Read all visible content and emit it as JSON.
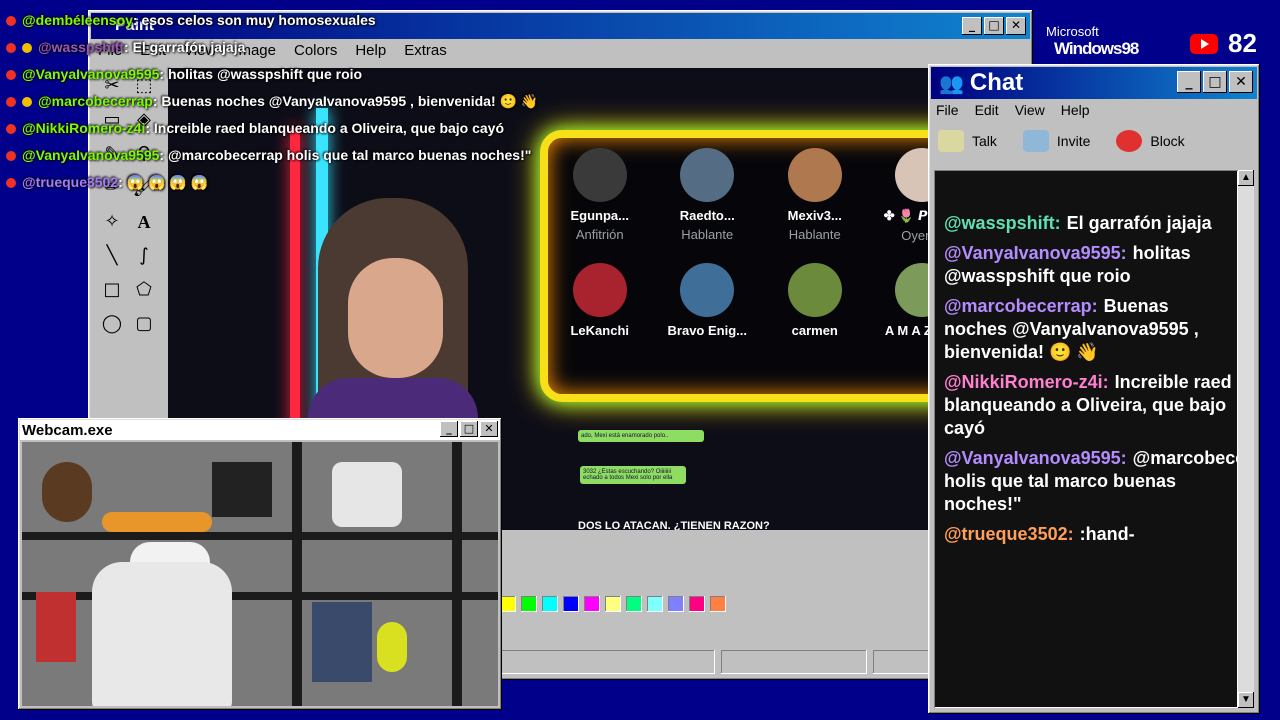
{
  "paint": {
    "title": "Paint",
    "menu": [
      "File",
      "Edit",
      "View",
      "Image",
      "Colors",
      "Help",
      "Extras"
    ],
    "palette": [
      "#ffff00",
      "#00ff00",
      "#00ffff",
      "#0000ff",
      "#ff00ff",
      "#ffff80",
      "#00ff80",
      "#80ffff",
      "#8080ff",
      "#ff0080",
      "#ff8040"
    ]
  },
  "stream": {
    "speakers": [
      {
        "name": "Egunpa...",
        "role": "Anfitrión"
      },
      {
        "name": "Raedto...",
        "role": "Hablante"
      },
      {
        "name": "Mexiv3...",
        "role": "Hablante"
      },
      {
        "name": "✤ 🌷 𝙋𝙞𝙣𝙠...",
        "role": "Oyente"
      },
      {
        "name": "LeKanchi",
        "role": ""
      },
      {
        "name": "Bravo Enig...",
        "role": ""
      },
      {
        "name": "carmen",
        "role": ""
      },
      {
        "name": "A M A Z ⃠ ...",
        "role": ""
      }
    ],
    "banner": "DOS LO ATACAN. ¿TIENEN RAZON?",
    "notif1": "ado, Mexi está enamorado polo..",
    "notif2": "3032 ¿Estas escuchando? Oiiiiiiii",
    "notif3": "echado a todos Mexi solo por ella"
  },
  "overlay_chat": [
    {
      "user": "@dembéleensoy",
      "text": ": esos celos son muy homosexuales",
      "color": "#7cfc00"
    },
    {
      "user": "@wasspshift",
      "text": ": El garrafón jajaja",
      "color": "#9b59b6"
    },
    {
      "user": "@VanyaIvanova9595",
      "text": ": holitas @wasspshift que roio",
      "color": "#a77bff"
    },
    {
      "user": "@marcobecerrap",
      "text": ": Buenas noches @VanyaIvanova9595 , bienvenida! 🙂 👋",
      "color": "#7cfc00"
    },
    {
      "user": "@NikkiRomero-z4i",
      "text": ": Increible raed blanqueando a Oliveira, que bajo cayó",
      "color": "#7cfc00"
    },
    {
      "user": "@VanyaIvanova9595",
      "text": ": @marcobecerrap holis que tal marco buenas noches!\"",
      "color": "#a77bff"
    },
    {
      "user": "@trueque3502",
      "text": ": 😱 😱 😱 😱",
      "color": "#a77bff"
    }
  ],
  "brand": {
    "microsoft": "Microsoft",
    "windows": "Windows98"
  },
  "youtube": {
    "viewers": "82"
  },
  "chat": {
    "title": "Chat",
    "menu": [
      "File",
      "Edit",
      "View",
      "Help"
    ],
    "toolbar": [
      "Talk",
      "Invite",
      "Block"
    ],
    "messages": [
      {
        "user": "@wasspshift:",
        "text": "El garrafón jajaja",
        "color": "#5fe0b0"
      },
      {
        "user": "@VanyaIvanova9595:",
        "text": "holitas @wasspshift que roio",
        "color": "#b48cff"
      },
      {
        "user": "@marcobecerrap:",
        "text": "Buenas noches @VanyaIvanova9595 , bienvenida! 🙂 👋",
        "color": "#b48cff"
      },
      {
        "user": "@NikkiRomero-z4i:",
        "text": "Increible raed blanqueando a Oliveira, que bajo cayó",
        "color": "#ff7fd0"
      },
      {
        "user": "@VanyaIvanova9595:",
        "text": "@marcobecerrap holis que tal marco buenas noches!\"",
        "color": "#b48cff"
      },
      {
        "user": "@trueque3502:",
        "text": ":hand-",
        "color": "#ff9f5a"
      }
    ]
  },
  "webcam": {
    "title": "Webcam.exe"
  }
}
